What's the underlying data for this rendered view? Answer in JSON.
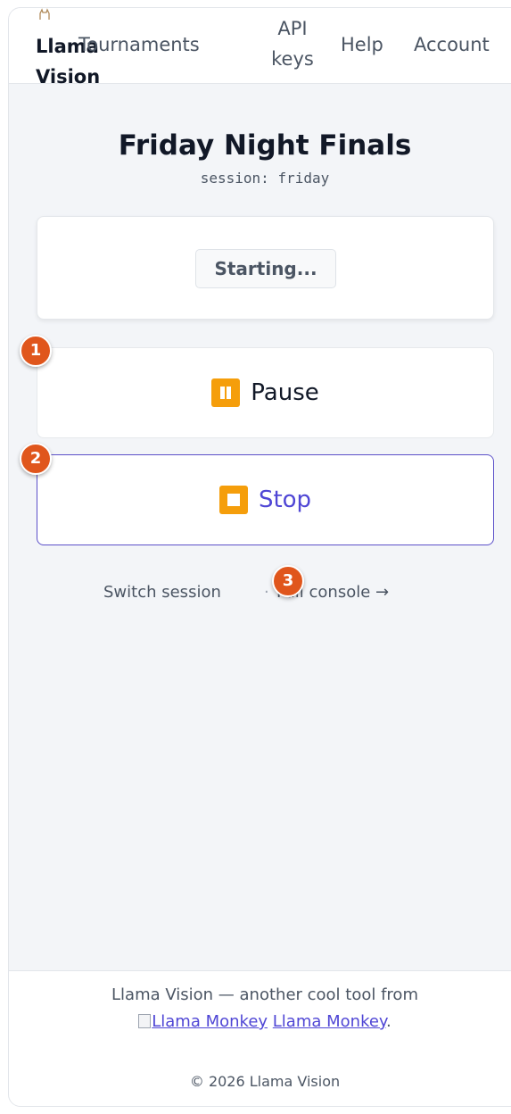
{
  "nav": {
    "brand_line1": "Llama",
    "brand_line2": "Vision",
    "tournaments": "Tournaments",
    "api_line1": "API",
    "api_line2": "keys",
    "help": "Help",
    "account": "Account"
  },
  "page": {
    "title": "Friday Night Finals",
    "session": "session: friday"
  },
  "status": {
    "label": "Starting..."
  },
  "controls": {
    "pause_label": "Pause",
    "stop_label": "Stop"
  },
  "links": {
    "switch_session": "Switch session",
    "separator": "·",
    "full_console": "Full console →"
  },
  "badges": [
    "1",
    "2",
    "3"
  ],
  "footer": {
    "line1": "Llama Vision — another cool tool from",
    "img_alt": "Llama Monkey",
    "link_label": "Llama Monkey",
    "period": ".",
    "copyright": "© 2026 Llama Vision"
  },
  "colors": {
    "accent": "#4f46d5",
    "icon_bg": "#f59e0b",
    "badge": "#e0561c"
  },
  "icons": {
    "brand": "llama-logo-icon",
    "pause": "pause-icon",
    "stop": "stop-icon"
  }
}
